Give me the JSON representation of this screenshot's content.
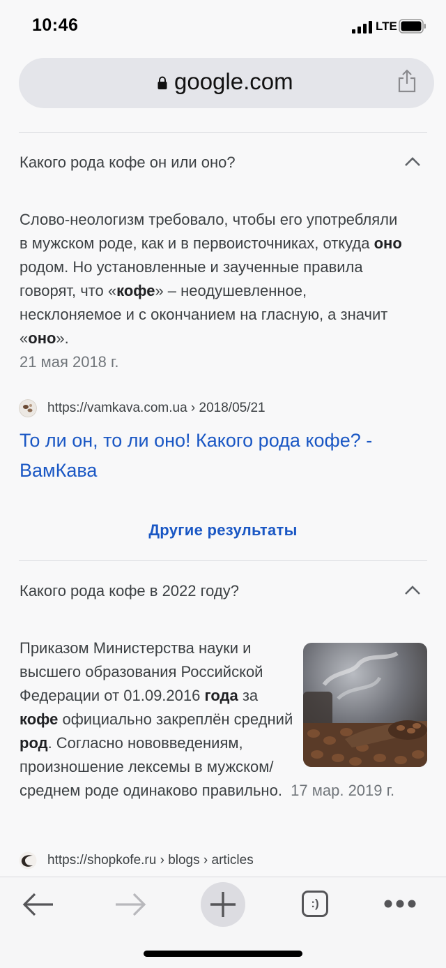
{
  "status_bar": {
    "time": "10:46",
    "network": "LTE"
  },
  "address_bar": {
    "domain": "google.com"
  },
  "faq": [
    {
      "question": "Какого рода кофе он или оно?",
      "answer_parts": {
        "p1": "Слово-неологизм требовало, чтобы его употребляли в мужском роде, как и в первоисточниках, откуда ",
        "b1": "оно",
        "p2": " родом. Но установленные и заученные правила говорят, что «",
        "b2": "кофе",
        "p3": "» – неодушевленное, несклоняемое и с окончанием на гласную, а значит «",
        "b3": "оно",
        "p4": "»."
      },
      "date": "21 мая 2018 г.",
      "source_url": "https://vamkava.com.ua › 2018/05/21",
      "result_title": "То ли он, то ли оно! Какого рода кофе? - ВамКава"
    },
    {
      "question": "Какого рода кофе в 2022 году?",
      "answer_parts": {
        "p1": "Приказом Министерства науки и высшего образования Российской Федерации от 01.09.2016 ",
        "b1": "года",
        "p2": " за ",
        "b2": "кофе",
        "p3": " официально закреплён средний ",
        "b3": "род",
        "p4": ". Согласно нововведениям, произношение лексемы в мужском/среднем роде одинаково правильно."
      },
      "date": "17 мар. 2019 г.",
      "source_url": "https://shopkofe.ru › blogs › articles"
    }
  ],
  "more_results": "Другие результаты",
  "toolbar": {
    "icons": [
      "back-arrow-icon",
      "forward-arrow-icon",
      "new-tab-plus-icon",
      "tabs-icon",
      "more-dots-icon"
    ],
    "tabs_label": ":)"
  }
}
